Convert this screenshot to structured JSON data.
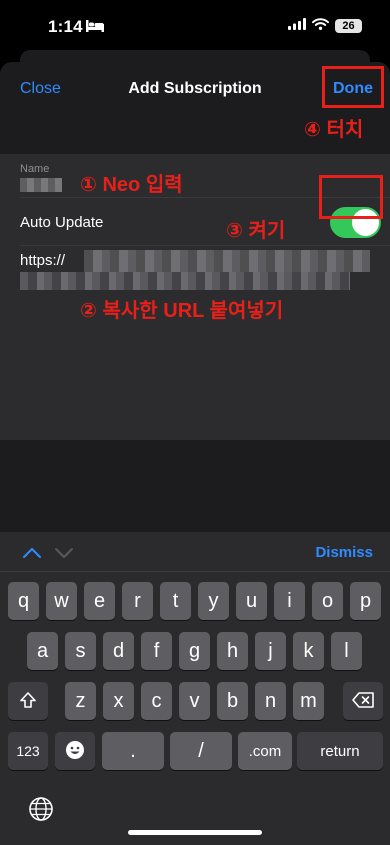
{
  "status": {
    "time": "1:14",
    "battery": "26"
  },
  "nav": {
    "close": "Close",
    "title": "Add Subscription",
    "done": "Done"
  },
  "form": {
    "name_label": "Name",
    "auto_update_label": "Auto Update",
    "auto_update_on": true,
    "url_prefix": "https://"
  },
  "annotations": {
    "done": "④ 터치",
    "name": "① Neo 입력",
    "toggle": "③ 켜기",
    "url": "② 복사한 URL 붙여넣기"
  },
  "keyboard": {
    "dismiss": "Dismiss",
    "row1": [
      "q",
      "w",
      "e",
      "r",
      "t",
      "y",
      "u",
      "i",
      "o",
      "p"
    ],
    "row2": [
      "a",
      "s",
      "d",
      "f",
      "g",
      "h",
      "j",
      "k",
      "l"
    ],
    "row3": [
      "z",
      "x",
      "c",
      "v",
      "b",
      "n",
      "m"
    ],
    "numbers": "123",
    "dot": ".",
    "slash": "/",
    "dotcom": ".com",
    "return": "return"
  },
  "colors": {
    "accent": "#2f8bff",
    "annotation": "#e8201a",
    "toggle_on": "#34c759"
  }
}
